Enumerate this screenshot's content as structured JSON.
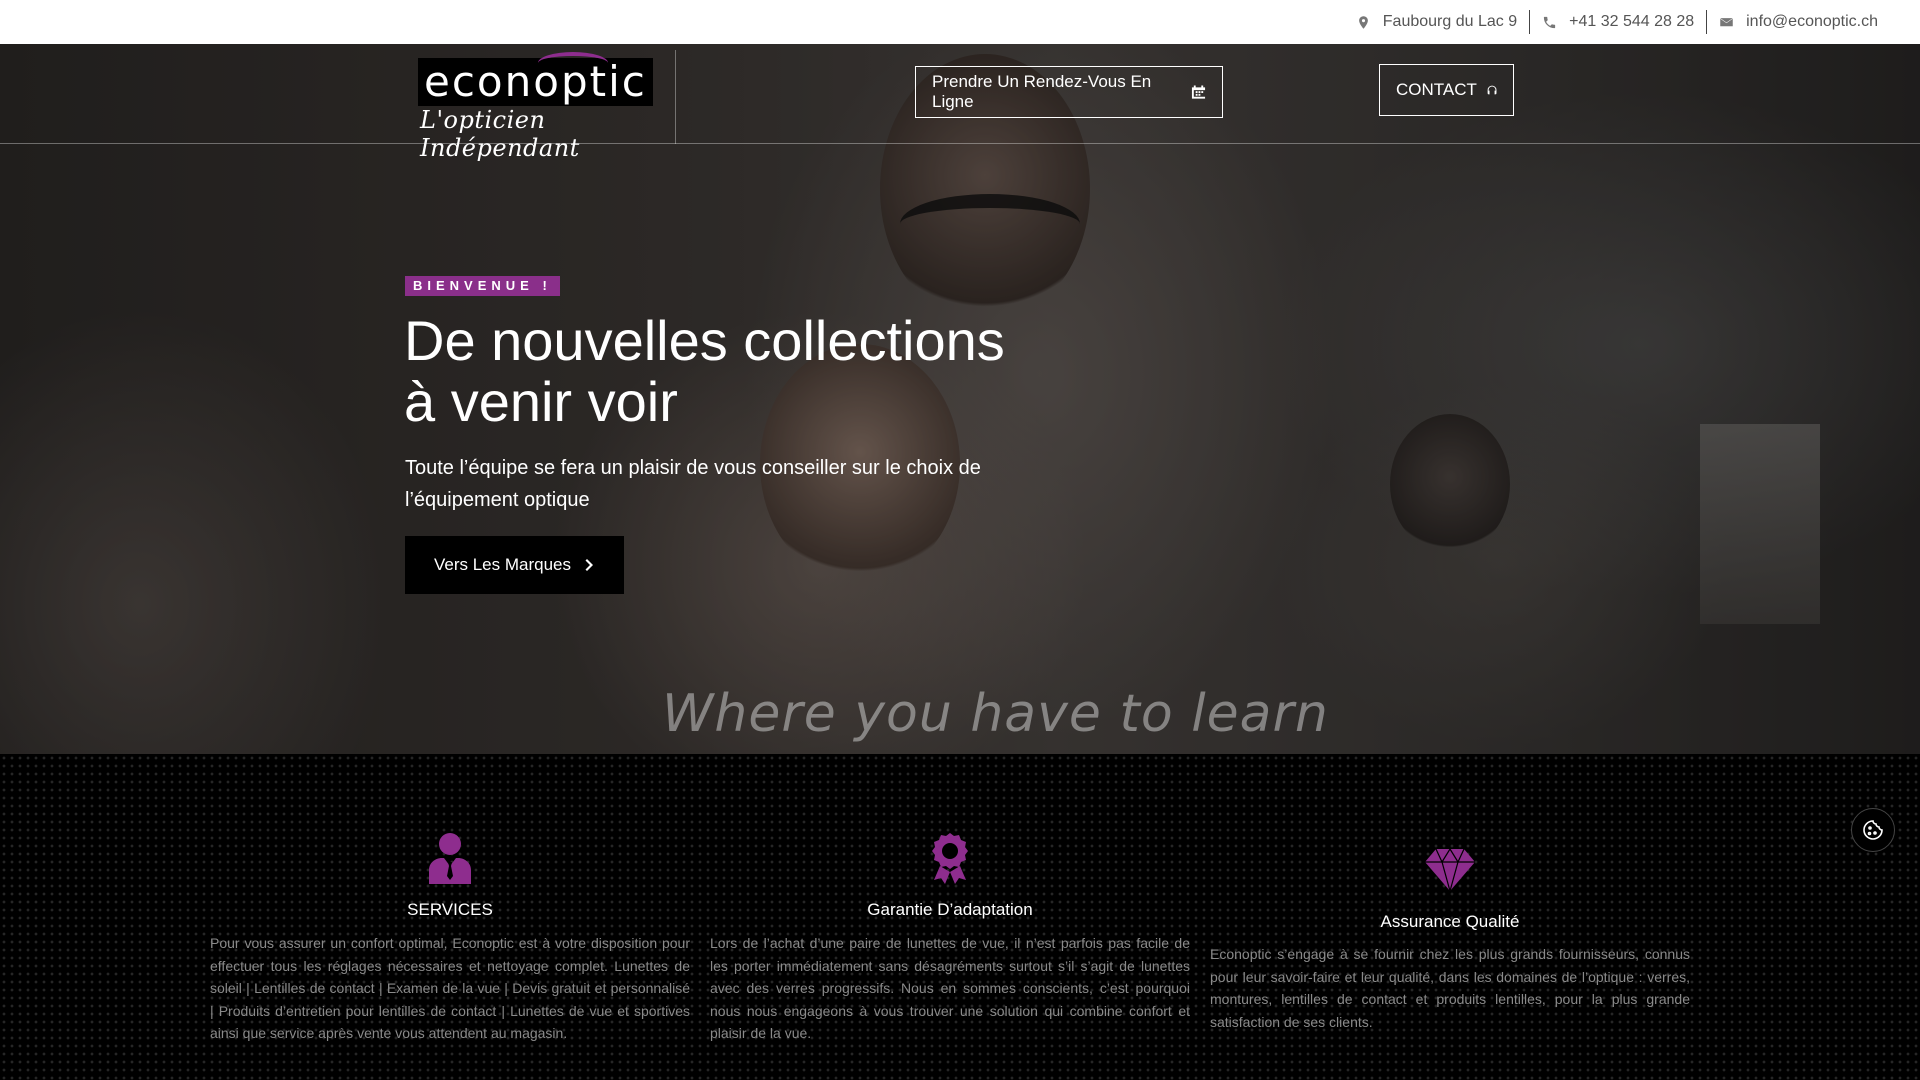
{
  "topbar": {
    "address": "Faubourg du Lac 9",
    "phone": "+41 32 544 28 28",
    "email": "info@econoptic.ch"
  },
  "header": {
    "logo_text": "econoptic",
    "logo_tagline": "L'opticien Indépendant",
    "rdv_button": "Prendre Un Rendez-Vous En Ligne",
    "contact_button": "CONTACT"
  },
  "hero": {
    "badge": "BIENVENUE !",
    "title_line1": "De nouvelles collections",
    "title_line2": "à venir voir",
    "lead": "Toute l’équipe se fera un plaisir de vous conseiller sur le choix de l’équipement optique",
    "cta": "Vers Les Marques",
    "tagline": "Where you have to learn"
  },
  "features": [
    {
      "icon": "person-suit-icon",
      "title": "SERVICES",
      "text": "Pour vous assurer un confort optimal, Econoptic est à votre disposition pour effectuer tous les réglages nécessaires et nettoyage complet. Lunettes de soleil | Lentilles de contact | Examen de la vue | Devis gratuit et personnalisé | Produits d’entretien pour lentilles de contact | Lunettes de vue et sportives ainsi que service après vente vous attendent au magasin."
    },
    {
      "icon": "award-ribbon-icon",
      "title": "Garantie D’adaptation",
      "text": "Lors de l’achat d’une paire de lunettes de vue, il n’est parfois pas facile de les porter immédiatement sans désagréments surtout s’il s’agit de lunettes avec des verres progressifs. Nous en sommes conscients, c’est pourquoi nous nous engageons à vous trouver une solution qui combine confort et plaisir de la vue."
    },
    {
      "icon": "diamond-icon",
      "title": "Assurance Qualité",
      "text": "Econoptic s’engage à se fournir chez les plus grands fournisseurs, connus pour leur savoir-faire et leur qualité, dans les domaines de l’optique : verres, montures, lentilles de contact et produits lentilles, pour la plus grande satisfaction de ses clients."
    }
  ],
  "colors": {
    "accent": "#8e2d8e",
    "topbar_bg": "#ffffff",
    "features_bg": "#000000"
  }
}
